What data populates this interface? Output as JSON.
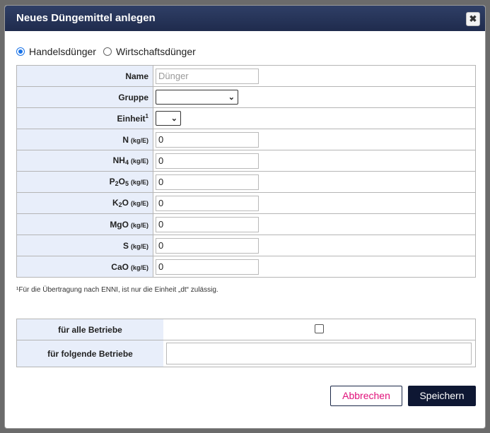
{
  "dialog": {
    "title": "Neues Düngemittel anlegen",
    "close_glyph": "✖"
  },
  "type_options": [
    {
      "label": "Handelsdünger",
      "checked": true
    },
    {
      "label": "Wirtschaftsdünger",
      "checked": false
    }
  ],
  "fields": {
    "name": {
      "label": "Name",
      "placeholder": "Dünger",
      "value": ""
    },
    "gruppe": {
      "label": "Gruppe",
      "value": ""
    },
    "einheit": {
      "label": "Einheit",
      "sup": "1",
      "value": ""
    },
    "n": {
      "label": "N",
      "unit": "(kg/E)",
      "value": "0"
    },
    "nh4": {
      "label": "NH",
      "sub": "4",
      "unit": "(kg/E)",
      "value": "0"
    },
    "p2o5": {
      "label_a": "P",
      "sub_a": "2",
      "label_b": "O",
      "sub_b": "5",
      "unit": "(kg/E)",
      "value": "0"
    },
    "k2o": {
      "label_a": "K",
      "sub_a": "2",
      "label_b": "O",
      "unit": "(kg/E)",
      "value": "0"
    },
    "mgo": {
      "label": "MgO",
      "unit": "(kg/E)",
      "value": "0"
    },
    "s": {
      "label": "S",
      "unit": "(kg/E)",
      "value": "0"
    },
    "cao": {
      "label": "CaO",
      "unit": "(kg/E)",
      "value": "0"
    }
  },
  "footnote": "¹Für die Übertragung nach ENNI, ist nur die Einheit „dt“ zulässig.",
  "betriebe": {
    "all_label": "für alle Betriebe",
    "all_checked": false,
    "specific_label": "für folgende Betriebe",
    "specific_value": ""
  },
  "buttons": {
    "cancel": "Abbrechen",
    "save": "Speichern"
  },
  "colors": {
    "title_bar": "#1f2b4d",
    "label_bg": "#e8eefa",
    "cancel_text": "#e0117a",
    "save_bg": "#0e1733",
    "radio_accent": "#1a73e8"
  }
}
